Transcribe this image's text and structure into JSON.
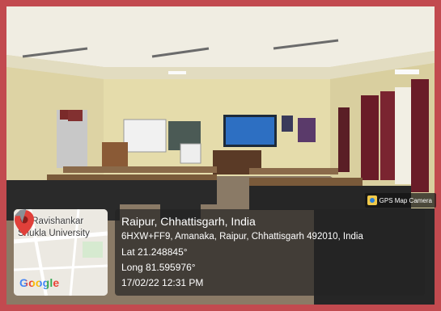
{
  "badge": {
    "text": "GPS Map Camera",
    "icon": "gps-map-camera-icon"
  },
  "location": {
    "city": "Raipur, Chhattisgarh, India",
    "address": "6HXW+FF9, Amanaka, Raipur, Chhattisgarh 492010, India",
    "lat": "Lat 21.248845°",
    "long": "Long 81.595976°",
    "datetime": "17/02/22 12:31 PM"
  },
  "map": {
    "label_line1": "Pt. Ravishankar",
    "label_line2": "Shukla University",
    "logo": "Google",
    "pin_icon": "map-pin-icon",
    "nav_icon": "navigation-icon"
  },
  "colors": {
    "frame": "#c24a4f",
    "pin": "#e0403a",
    "overlay": "#232323"
  }
}
